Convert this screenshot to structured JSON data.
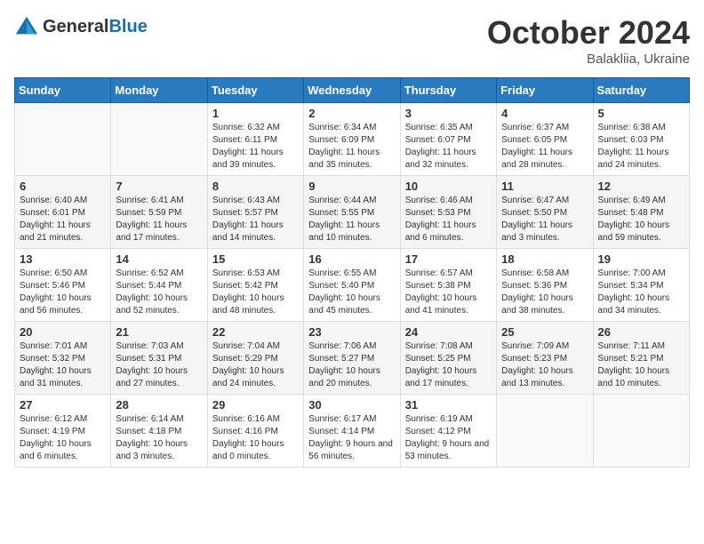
{
  "header": {
    "logo_general": "General",
    "logo_blue": "Blue",
    "month_title": "October 2024",
    "location": "Balakliia, Ukraine"
  },
  "weekdays": [
    "Sunday",
    "Monday",
    "Tuesday",
    "Wednesday",
    "Thursday",
    "Friday",
    "Saturday"
  ],
  "weeks": [
    [
      {
        "day": "",
        "info": ""
      },
      {
        "day": "",
        "info": ""
      },
      {
        "day": "1",
        "info": "Sunrise: 6:32 AM\nSunset: 6:11 PM\nDaylight: 11 hours and 39 minutes."
      },
      {
        "day": "2",
        "info": "Sunrise: 6:34 AM\nSunset: 6:09 PM\nDaylight: 11 hours and 35 minutes."
      },
      {
        "day": "3",
        "info": "Sunrise: 6:35 AM\nSunset: 6:07 PM\nDaylight: 11 hours and 32 minutes."
      },
      {
        "day": "4",
        "info": "Sunrise: 6:37 AM\nSunset: 6:05 PM\nDaylight: 11 hours and 28 minutes."
      },
      {
        "day": "5",
        "info": "Sunrise: 6:38 AM\nSunset: 6:03 PM\nDaylight: 11 hours and 24 minutes."
      }
    ],
    [
      {
        "day": "6",
        "info": "Sunrise: 6:40 AM\nSunset: 6:01 PM\nDaylight: 11 hours and 21 minutes."
      },
      {
        "day": "7",
        "info": "Sunrise: 6:41 AM\nSunset: 5:59 PM\nDaylight: 11 hours and 17 minutes."
      },
      {
        "day": "8",
        "info": "Sunrise: 6:43 AM\nSunset: 5:57 PM\nDaylight: 11 hours and 14 minutes."
      },
      {
        "day": "9",
        "info": "Sunrise: 6:44 AM\nSunset: 5:55 PM\nDaylight: 11 hours and 10 minutes."
      },
      {
        "day": "10",
        "info": "Sunrise: 6:46 AM\nSunset: 5:53 PM\nDaylight: 11 hours and 6 minutes."
      },
      {
        "day": "11",
        "info": "Sunrise: 6:47 AM\nSunset: 5:50 PM\nDaylight: 11 hours and 3 minutes."
      },
      {
        "day": "12",
        "info": "Sunrise: 6:49 AM\nSunset: 5:48 PM\nDaylight: 10 hours and 59 minutes."
      }
    ],
    [
      {
        "day": "13",
        "info": "Sunrise: 6:50 AM\nSunset: 5:46 PM\nDaylight: 10 hours and 56 minutes."
      },
      {
        "day": "14",
        "info": "Sunrise: 6:52 AM\nSunset: 5:44 PM\nDaylight: 10 hours and 52 minutes."
      },
      {
        "day": "15",
        "info": "Sunrise: 6:53 AM\nSunset: 5:42 PM\nDaylight: 10 hours and 48 minutes."
      },
      {
        "day": "16",
        "info": "Sunrise: 6:55 AM\nSunset: 5:40 PM\nDaylight: 10 hours and 45 minutes."
      },
      {
        "day": "17",
        "info": "Sunrise: 6:57 AM\nSunset: 5:38 PM\nDaylight: 10 hours and 41 minutes."
      },
      {
        "day": "18",
        "info": "Sunrise: 6:58 AM\nSunset: 5:36 PM\nDaylight: 10 hours and 38 minutes."
      },
      {
        "day": "19",
        "info": "Sunrise: 7:00 AM\nSunset: 5:34 PM\nDaylight: 10 hours and 34 minutes."
      }
    ],
    [
      {
        "day": "20",
        "info": "Sunrise: 7:01 AM\nSunset: 5:32 PM\nDaylight: 10 hours and 31 minutes."
      },
      {
        "day": "21",
        "info": "Sunrise: 7:03 AM\nSunset: 5:31 PM\nDaylight: 10 hours and 27 minutes."
      },
      {
        "day": "22",
        "info": "Sunrise: 7:04 AM\nSunset: 5:29 PM\nDaylight: 10 hours and 24 minutes."
      },
      {
        "day": "23",
        "info": "Sunrise: 7:06 AM\nSunset: 5:27 PM\nDaylight: 10 hours and 20 minutes."
      },
      {
        "day": "24",
        "info": "Sunrise: 7:08 AM\nSunset: 5:25 PM\nDaylight: 10 hours and 17 minutes."
      },
      {
        "day": "25",
        "info": "Sunrise: 7:09 AM\nSunset: 5:23 PM\nDaylight: 10 hours and 13 minutes."
      },
      {
        "day": "26",
        "info": "Sunrise: 7:11 AM\nSunset: 5:21 PM\nDaylight: 10 hours and 10 minutes."
      }
    ],
    [
      {
        "day": "27",
        "info": "Sunrise: 6:12 AM\nSunset: 4:19 PM\nDaylight: 10 hours and 6 minutes."
      },
      {
        "day": "28",
        "info": "Sunrise: 6:14 AM\nSunset: 4:18 PM\nDaylight: 10 hours and 3 minutes."
      },
      {
        "day": "29",
        "info": "Sunrise: 6:16 AM\nSunset: 4:16 PM\nDaylight: 10 hours and 0 minutes."
      },
      {
        "day": "30",
        "info": "Sunrise: 6:17 AM\nSunset: 4:14 PM\nDaylight: 9 hours and 56 minutes."
      },
      {
        "day": "31",
        "info": "Sunrise: 6:19 AM\nSunset: 4:12 PM\nDaylight: 9 hours and 53 minutes."
      },
      {
        "day": "",
        "info": ""
      },
      {
        "day": "",
        "info": ""
      }
    ]
  ]
}
